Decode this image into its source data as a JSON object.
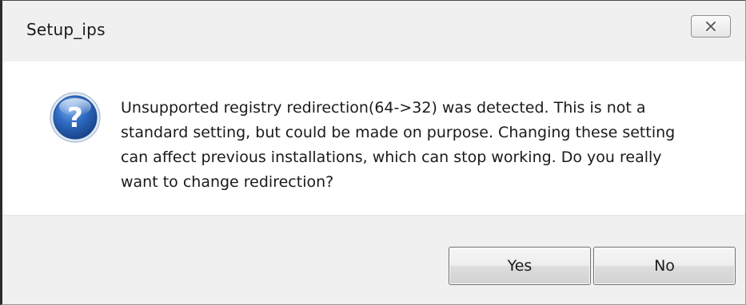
{
  "window": {
    "title": "Setup_ips",
    "close_icon": "close-icon"
  },
  "message": {
    "icon": "question-icon",
    "text": "Unsupported registry redirection(64->32) was detected. This is not a standard setting, but could be made on purpose. Changing these setting can affect previous installations, which can stop working. Do you really want to change redirection?"
  },
  "buttons": {
    "yes_label": "Yes",
    "no_label": "No"
  },
  "colors": {
    "icon_blue": "#2a63b8",
    "chrome_gray": "#f0f0f0"
  }
}
